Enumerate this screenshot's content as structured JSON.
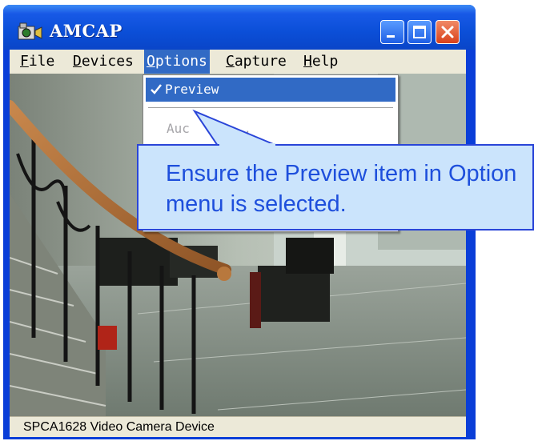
{
  "window": {
    "title": "AMCAP"
  },
  "menubar": {
    "items": [
      {
        "label": "File",
        "mnemonic": "F",
        "rest": "ile"
      },
      {
        "label": "Devices",
        "mnemonic": "D",
        "rest": "evices"
      },
      {
        "label": "Options",
        "mnemonic": "O",
        "rest": "ptions"
      },
      {
        "label": "Capture",
        "mnemonic": "C",
        "rest": "apture"
      },
      {
        "label": "Help",
        "mnemonic": "H",
        "rest": "elp"
      }
    ]
  },
  "options_menu": {
    "items": [
      {
        "label": "Preview",
        "checked": true,
        "state": "highlighted"
      },
      {
        "label": "Audio Format...",
        "visible_text": "Auc   at...",
        "state": "disabled"
      }
    ]
  },
  "callout": {
    "text": "Ensure the Preview item in Option menu is selected."
  },
  "statusbar": {
    "text": "SPCA1628 Video Camera Device"
  },
  "colors": {
    "titlebar": "#0a4fd8",
    "menu_highlight": "#316ac5",
    "callout_fill": "#cbe4fc",
    "callout_text": "#1e4fdc",
    "close_button": "#d9411b"
  }
}
